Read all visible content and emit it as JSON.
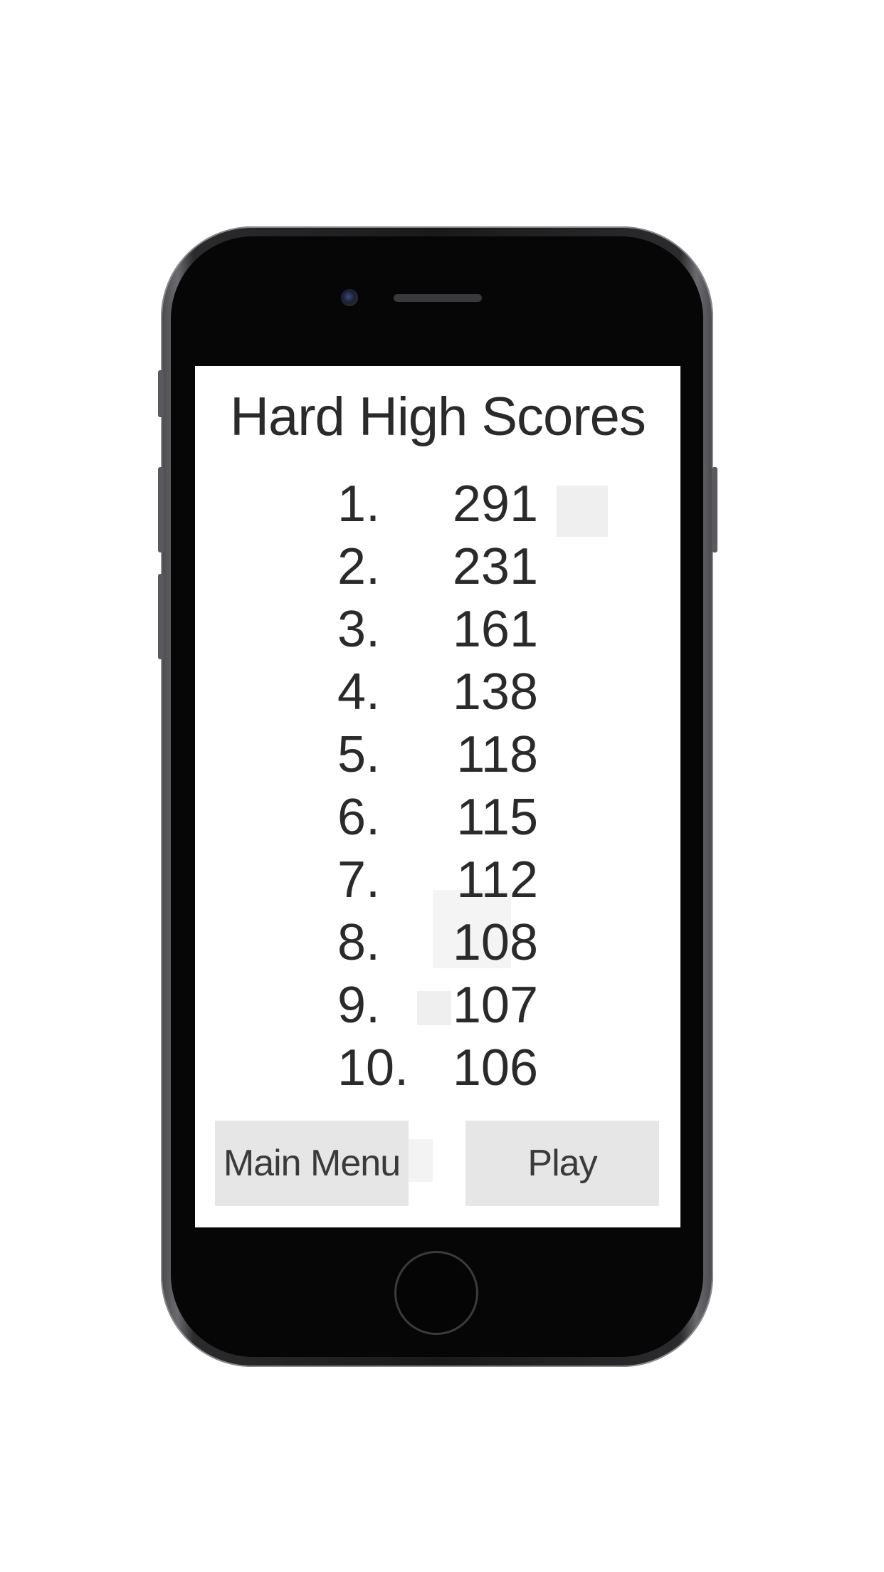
{
  "screen": {
    "title": "Hard High Scores",
    "scores": [
      {
        "rank": "1.",
        "value": "291"
      },
      {
        "rank": "2.",
        "value": "231"
      },
      {
        "rank": "3.",
        "value": "161"
      },
      {
        "rank": "4.",
        "value": "138"
      },
      {
        "rank": "5.",
        "value": "118"
      },
      {
        "rank": "6.",
        "value": "115"
      },
      {
        "rank": "7.",
        "value": "112"
      },
      {
        "rank": "8.",
        "value": "108"
      },
      {
        "rank": "9.",
        "value": "107"
      },
      {
        "rank": "10.",
        "value": "106"
      }
    ],
    "buttons": {
      "main_menu": "Main Menu",
      "play": "Play"
    }
  },
  "colors": {
    "screen_background": "#ffffff",
    "button_background": "#e6e6e6",
    "text": "#2a2a2a",
    "phone_bezel": "#060606"
  }
}
